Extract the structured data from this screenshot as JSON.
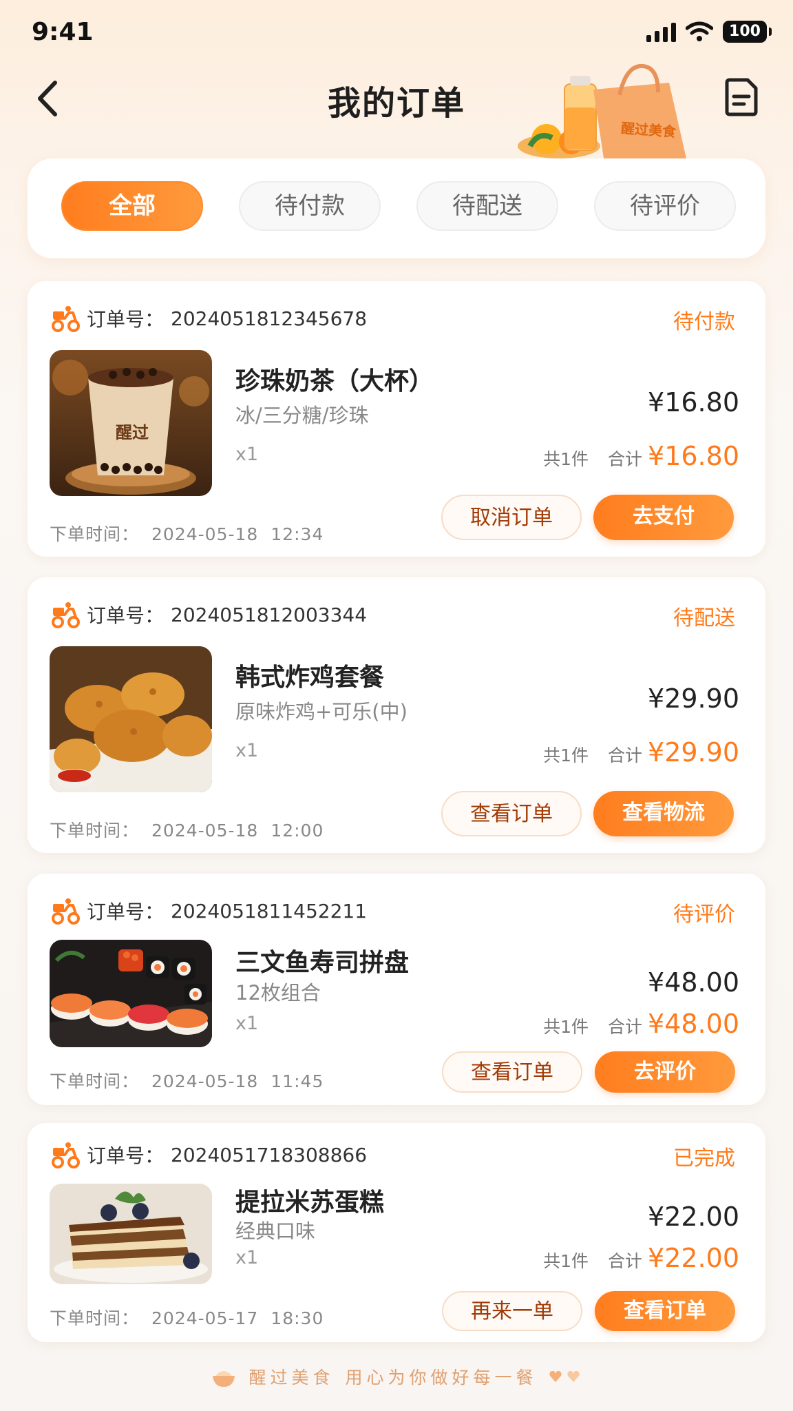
{
  "status_bar": {
    "time": "9:41",
    "battery": "100"
  },
  "nav": {
    "title": "我的订单",
    "deco_bag_text": "醒过美食"
  },
  "tabs": [
    {
      "label": "全部",
      "active": true
    },
    {
      "label": "待付款",
      "active": false
    },
    {
      "label": "待配送",
      "active": false
    },
    {
      "label": "待评价",
      "active": false
    }
  ],
  "labels": {
    "order_no": "订单号：",
    "order_time": "下单时间：",
    "count": "共1件",
    "total": "合计"
  },
  "orders": [
    {
      "order_no": "2024051812345678",
      "status": "待付款",
      "name": "珍珠奶茶（大杯）",
      "spec": "冰/三分糖/珍珠",
      "qty": "x1",
      "unit_price": "¥16.80",
      "total": "¥16.80",
      "date": "2024-05-18",
      "time": "12:34",
      "cup_text": "醒过",
      "btn_secondary": "取消订单",
      "btn_primary": "去支付"
    },
    {
      "order_no": "2024051812003344",
      "status": "待配送",
      "name": "韩式炸鸡套餐",
      "spec": "原味炸鸡+可乐(中)",
      "qty": "x1",
      "unit_price": "¥29.90",
      "total": "¥29.90",
      "date": "2024-05-18",
      "time": "12:00",
      "btn_secondary": "查看订单",
      "btn_primary": "查看物流"
    },
    {
      "order_no": "2024051811452211",
      "status": "待评价",
      "name": "三文鱼寿司拼盘",
      "spec": "12枚组合",
      "qty": "x1",
      "unit_price": "¥48.00",
      "total": "¥48.00",
      "date": "2024-05-18",
      "time": "11:45",
      "btn_secondary": "查看订单",
      "btn_primary": "去评价"
    },
    {
      "order_no": "2024051718308866",
      "status": "已完成",
      "name": "提拉米苏蛋糕",
      "spec": "经典口味",
      "qty": "x1",
      "unit_price": "¥22.00",
      "total": "¥22.00",
      "date": "2024-05-17",
      "time": "18:30",
      "btn_secondary": "再来一单",
      "btn_primary": "查看订单"
    }
  ],
  "footer": {
    "brand": "醒过美食",
    "slogan": "用心为你做好每一餐"
  },
  "colors": {
    "accent": "#ff7a1a",
    "outline_text": "#a13b07"
  }
}
